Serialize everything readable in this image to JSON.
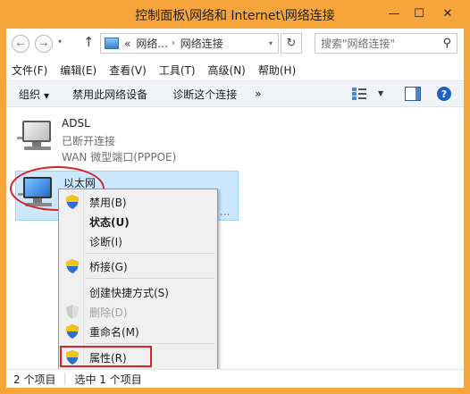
{
  "window": {
    "title": "控制面板\\网络和 Internet\\网络连接",
    "minimize_glyph": "—",
    "maximize_glyph": "☐",
    "close_glyph": "✕"
  },
  "navigation": {
    "back_glyph": "←",
    "forward_glyph": "→",
    "history_glyph": "▾",
    "up_glyph": "↑",
    "address": {
      "prefix": "«",
      "crumb1": "网络...",
      "separator": "›",
      "crumb2": "网络连接"
    },
    "refresh_glyph": "↻",
    "search": {
      "placeholder": "搜索\"网络连接\"",
      "icon": "search-icon",
      "glyph": "⚲"
    }
  },
  "menubar": {
    "file": "文件(F)",
    "edit": "编辑(E)",
    "view": "查看(V)",
    "tools": "工具(T)",
    "advanced": "高级(N)",
    "help": "帮助(H)"
  },
  "commandbar": {
    "organize": "组织",
    "caret_glyph": "▼",
    "disable_device": "禁用此网络设备",
    "diagnose": "诊断这个连接",
    "more": "»",
    "help_glyph": "?"
  },
  "connections": [
    {
      "name": "ADSL",
      "status": "已断开连接",
      "device": "WAN 微型端口(PPPOE)",
      "icon": "network-computer-icon"
    },
    {
      "name": "以太网",
      "status": "",
      "device": "...",
      "icon": "network-computer-icon",
      "selected": true
    }
  ],
  "context_menu": {
    "items": [
      {
        "label": "禁用(B)",
        "shield": true,
        "bold": false,
        "disabled": false
      },
      {
        "label": "状态(U)",
        "shield": false,
        "bold": true,
        "disabled": false
      },
      {
        "label": "诊断(I)",
        "shield": false,
        "bold": false,
        "disabled": false
      },
      {
        "label": "桥接(G)",
        "shield": true,
        "bold": false,
        "disabled": false
      },
      {
        "label": "创建快捷方式(S)",
        "shield": false,
        "bold": false,
        "disabled": false
      },
      {
        "label": "删除(D)",
        "shield": true,
        "bold": false,
        "disabled": true
      },
      {
        "label": "重命名(M)",
        "shield": true,
        "bold": false,
        "disabled": false
      },
      {
        "label": "属性(R)",
        "shield": true,
        "bold": false,
        "disabled": false
      }
    ]
  },
  "statusbar": {
    "count": "2 个项目",
    "selected": "选中 1 个项目"
  },
  "colors": {
    "frame": "#f6a53a",
    "highlight": "#d8232a",
    "selection": "#cce8ff"
  }
}
